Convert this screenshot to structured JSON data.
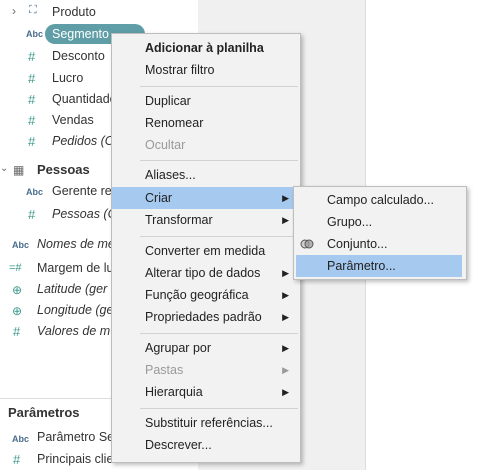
{
  "data_pane": {
    "rows": [
      {
        "icon": "hierarchy-icon",
        "glyph": "⛶",
        "label": "Produto"
      },
      {
        "icon": "abc-icon",
        "glyph": "Abc",
        "label": "Segmento"
      },
      {
        "icon": "measure-icon",
        "glyph": "#",
        "label": "Desconto"
      },
      {
        "icon": "measure-icon",
        "glyph": "#",
        "label": "Lucro"
      },
      {
        "icon": "measure-icon",
        "glyph": "#",
        "label": "Quantidade"
      },
      {
        "icon": "measure-icon",
        "glyph": "#",
        "label": "Vendas"
      },
      {
        "icon": "measure-icon",
        "glyph": "#",
        "label": "Pedidos (C"
      },
      {
        "icon": "table-icon",
        "glyph": "▦",
        "label": "Pessoas"
      },
      {
        "icon": "abc-icon",
        "glyph": "Abc",
        "label": "Gerente re"
      },
      {
        "icon": "measure-icon",
        "glyph": "#",
        "label": "Pessoas (C"
      },
      {
        "icon": "abc-icon",
        "glyph": "Abc",
        "label": "Nomes de me"
      },
      {
        "icon": "measure-icon",
        "glyph": "=#",
        "label": "Margem de lu"
      },
      {
        "icon": "globe-icon",
        "glyph": "⊕",
        "label": "Latitude (ger"
      },
      {
        "icon": "globe-icon",
        "glyph": "⊕",
        "label": "Longitude (ge"
      },
      {
        "icon": "measure-icon",
        "glyph": "#",
        "label": "Valores de m"
      }
    ],
    "parameters_title": "Parâmetros",
    "parameters": [
      {
        "icon": "abc-icon",
        "glyph": "Abc",
        "label": "Parâmetro Se"
      },
      {
        "icon": "measure-icon",
        "glyph": "#",
        "label": "Principais clientes"
      }
    ]
  },
  "menu": {
    "items": [
      {
        "label": "Adicionar à planilha"
      },
      {
        "label": "Mostrar filtro"
      },
      {
        "label": "Duplicar"
      },
      {
        "label": "Renomear"
      },
      {
        "label": "Ocultar"
      },
      {
        "label": "Aliases..."
      },
      {
        "label": "Criar"
      },
      {
        "label": "Transformar"
      },
      {
        "label": "Converter em medida"
      },
      {
        "label": "Alterar tipo de dados"
      },
      {
        "label": "Função geográfica"
      },
      {
        "label": "Propriedades padrão"
      },
      {
        "label": "Agrupar por"
      },
      {
        "label": "Pastas"
      },
      {
        "label": "Hierarquia"
      },
      {
        "label": "Substituir referências..."
      },
      {
        "label": "Descrever..."
      }
    ],
    "submenu_arrow": "▶"
  },
  "submenu": {
    "items": [
      {
        "label": "Campo calculado..."
      },
      {
        "label": "Grupo..."
      },
      {
        "label": "Conjunto..."
      },
      {
        "label": "Parâmetro..."
      }
    ]
  },
  "colors": {
    "highlight": "#a6c9ef",
    "pill": "#5f9ea6",
    "menu_bg": "#f2f2f2"
  }
}
